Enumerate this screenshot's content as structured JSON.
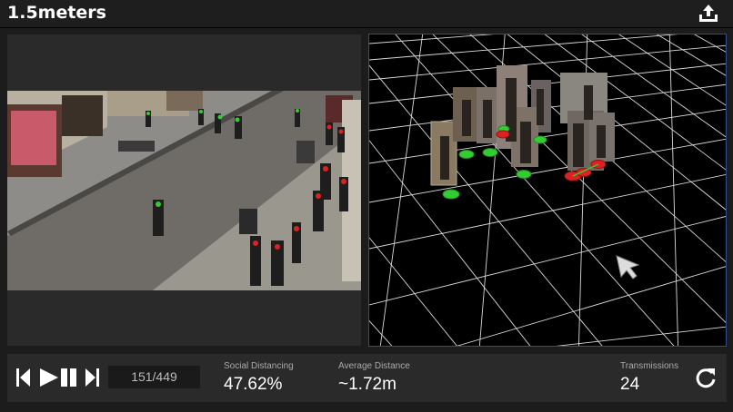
{
  "header": {
    "title": "1.5meters",
    "upload_icon": "upload-icon"
  },
  "player": {
    "frame_counter": "151/449",
    "controls": [
      "skip-back-icon",
      "play-pause-icon",
      "skip-forward-icon"
    ]
  },
  "stats": {
    "social_distancing_label": "Social Distancing",
    "social_distancing_value": "47.62%",
    "average_distance_label": "Average Distance",
    "average_distance_value": "~1.72m",
    "transmissions_label": "Transmissions",
    "transmissions_value": "24"
  },
  "colors": {
    "safe_marker": "#33cc33",
    "unsafe_marker": "#dd2222",
    "grid_line": "#ffffff",
    "panel_border": "#2e4f8f"
  }
}
